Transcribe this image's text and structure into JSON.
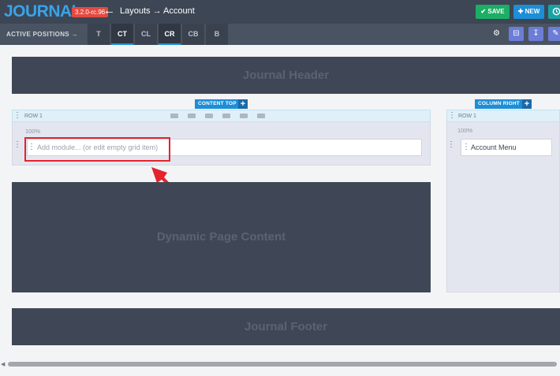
{
  "topbar": {
    "logo": "JOURNAL",
    "version": "3.2.0-rc.96",
    "breadcrumb": "Layouts → Account",
    "save": "SAVE",
    "new": "NEW"
  },
  "positions": {
    "label": "ACTIVE POSITIONS",
    "tabs": [
      "T",
      "CT",
      "CL",
      "CR",
      "CB",
      "B"
    ],
    "active": [
      "CT",
      "CR"
    ]
  },
  "blocks": {
    "header": "Journal Header",
    "page_content": "Dynamic Page Content",
    "footer": "Journal Footer"
  },
  "content_top": {
    "title": "CONTENT TOP",
    "row_label": "ROW 1",
    "width": "100%",
    "placeholder": "Add module... (or edit empty grid item)"
  },
  "column_right": {
    "title": "COLUMN RIGHT",
    "row_label": "ROW 1",
    "width": "100%",
    "module": "Account Menu"
  },
  "colors": {
    "accent": "#1d8ed7",
    "save": "#1cae65",
    "highlight": "#e4242b"
  }
}
